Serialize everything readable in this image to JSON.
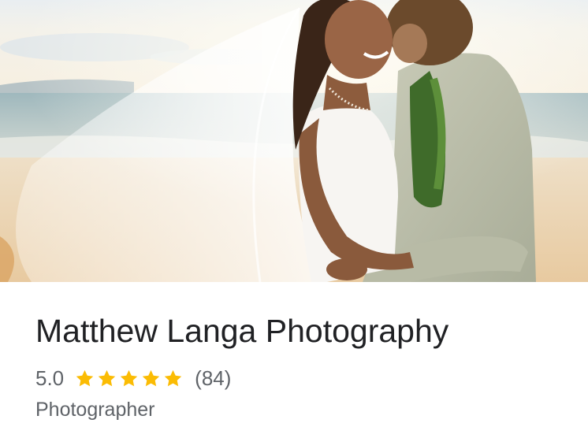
{
  "listing": {
    "name": "Matthew Langa Photography",
    "rating": "5.0",
    "review_count": "(84)",
    "stars": 5,
    "star_color": "#FBBC04",
    "category": "Photographer"
  },
  "photo": {
    "icon": "wedding-couple-beach-photo"
  }
}
